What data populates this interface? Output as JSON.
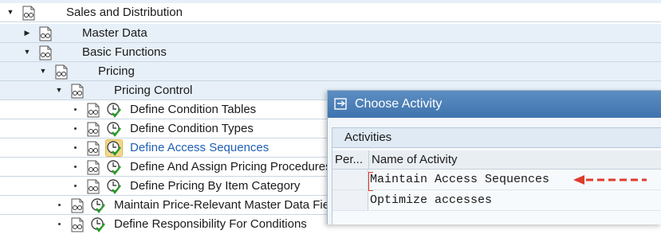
{
  "tree": {
    "rows": [
      {
        "label": "Sales and Distribution",
        "state": "expanded"
      },
      {
        "label": "Master Data",
        "state": "collapsed"
      },
      {
        "label": "Basic Functions",
        "state": "expanded"
      },
      {
        "label": "Pricing",
        "state": "expanded"
      },
      {
        "label": "Pricing Control",
        "state": "expanded"
      },
      {
        "label": "Define Condition Tables",
        "state": "leaf"
      },
      {
        "label": "Define Condition Types",
        "state": "leaf"
      },
      {
        "label": "Define Access Sequences",
        "state": "leaf",
        "selected": true
      },
      {
        "label": "Define And Assign Pricing Procedures",
        "state": "leaf"
      },
      {
        "label": "Define Pricing By Item Category",
        "state": "leaf"
      },
      {
        "label": "Maintain Price-Relevant Master Data Fields",
        "state": "leaf"
      },
      {
        "label": "Define Responsibility For Conditions",
        "state": "leaf"
      }
    ]
  },
  "dialog": {
    "title": "Choose Activity",
    "group_label": "Activities",
    "columns": {
      "per": "Per...",
      "name": "Name of Activity"
    },
    "activities": [
      {
        "name": "Maintain Access Sequences"
      },
      {
        "name": "Optimize accesses"
      }
    ]
  },
  "colors": {
    "row_blue": "#e7f0f8",
    "title_bar": "#4a7fb8",
    "link_text": "#1f5fb3",
    "arrow_red": "#e03a2e"
  },
  "icons": {
    "node": "glasses-document-icon",
    "activity": "clock-check-icon",
    "dialog_title": "choose-activity-icon"
  }
}
